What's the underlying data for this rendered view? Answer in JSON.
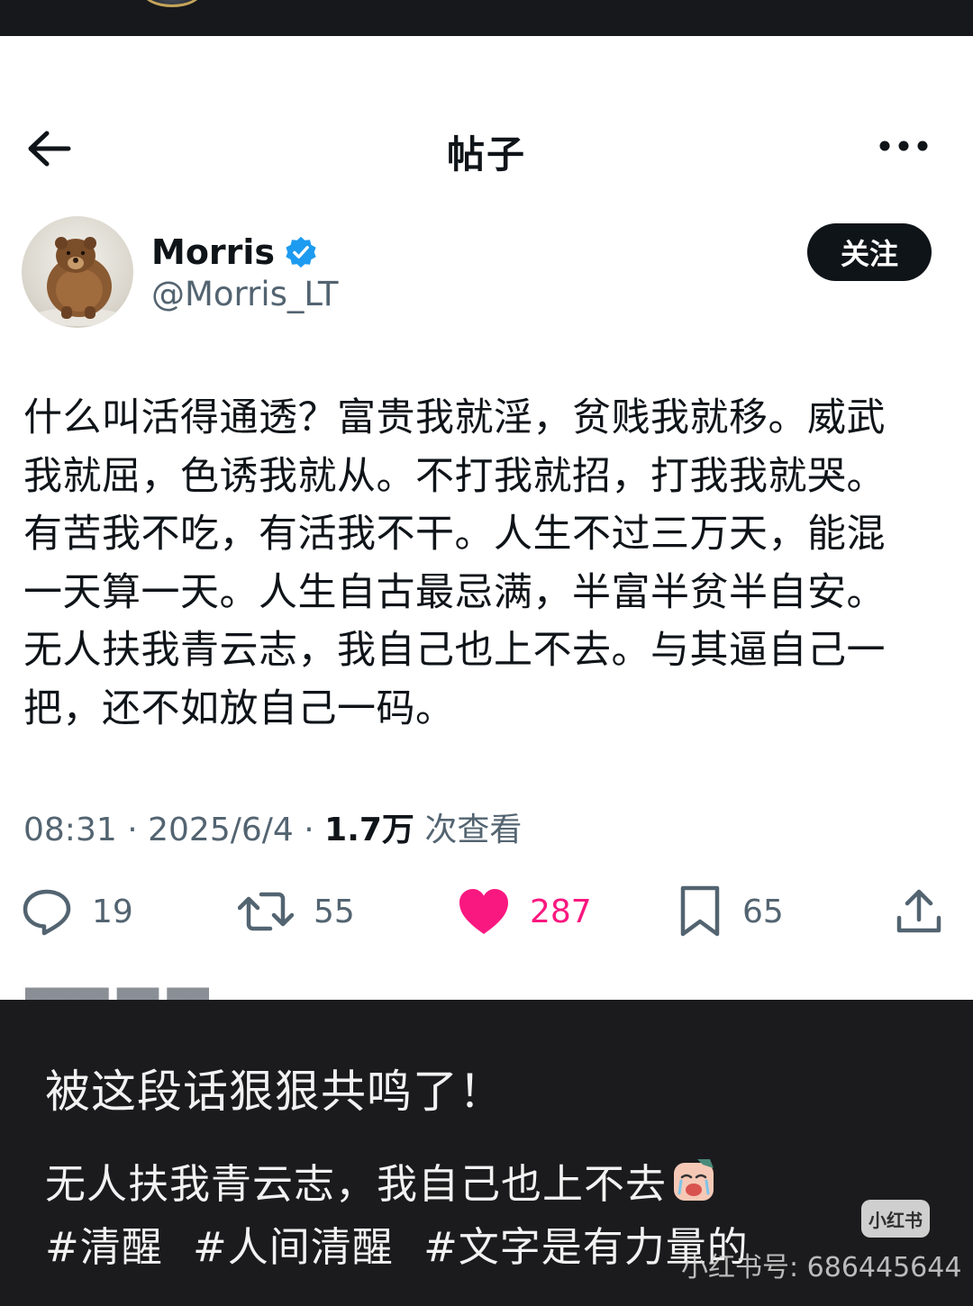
{
  "header": {
    "title": "帖子",
    "back_icon": "arrow-left-icon",
    "more_icon": "more-horizontal-icon"
  },
  "author": {
    "name": "Morris",
    "handle": "@Morris_LT",
    "verified": true,
    "verified_color": "#1d9bf0",
    "follow_label": "关注"
  },
  "post": {
    "lines": [
      "什么叫活得通透？富贵我就淫，贫贱我就移。威武",
      "我就屈，色诱我就从。不打我就招，打我我就哭。",
      "有苦我不吃，有活我不干。人生不过三万天，能混",
      "一天算一天。人生自古最忌满，半富半贫半自安。",
      "无人扶我青云志，我自己也上不去。与其逼自己一",
      "把，还不如放自己一码。"
    ]
  },
  "meta": {
    "time": "08:31",
    "date": "2025/6/4",
    "separator": "·",
    "views": "1.7万",
    "views_suffix": "次查看"
  },
  "actions": {
    "reply": {
      "icon": "reply-icon",
      "count": "19"
    },
    "repost": {
      "icon": "repost-icon",
      "count": "55"
    },
    "like": {
      "icon": "heart-icon",
      "count": "287",
      "color": "#f91880"
    },
    "bookmark": {
      "icon": "bookmark-icon",
      "count": "65"
    },
    "share": {
      "icon": "share-icon"
    }
  },
  "overlay": {
    "title": "被这段话狠狠共鸣了！",
    "line": "无人扶我青云志，我自己也上不去",
    "tags": [
      "#清醒",
      "#人间清醒",
      "#文字是有力量的"
    ],
    "watermark_badge": "小红书",
    "watermark_id": "小红书号: 686445644"
  }
}
